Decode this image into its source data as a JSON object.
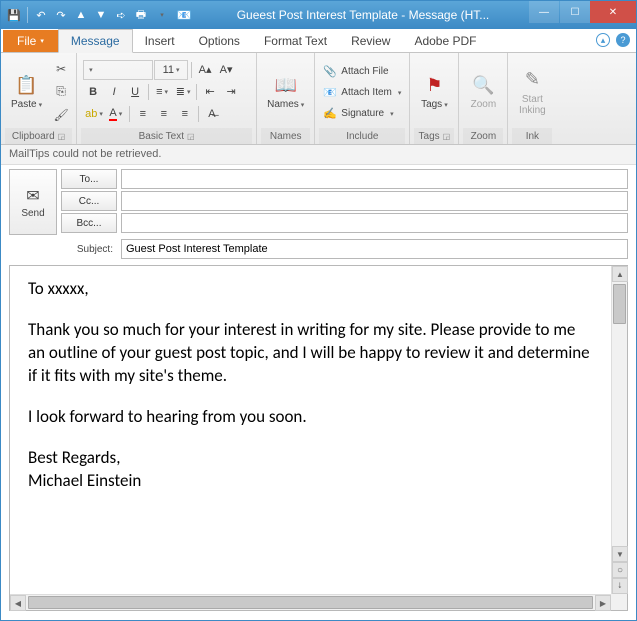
{
  "window": {
    "title": "Gueest Post Interest Template - Message (HT..."
  },
  "tabs": {
    "file": "File",
    "message": "Message",
    "insert": "Insert",
    "options": "Options",
    "format_text": "Format Text",
    "review": "Review",
    "adobe_pdf": "Adobe PDF"
  },
  "ribbon": {
    "clipboard": {
      "label": "Clipboard",
      "paste": "Paste"
    },
    "basic_text": {
      "label": "Basic Text",
      "font_size": "11"
    },
    "names": {
      "label": "Names",
      "names_btn": "Names"
    },
    "include": {
      "label": "Include",
      "attach_file": "Attach File",
      "attach_item": "Attach Item",
      "signature": "Signature"
    },
    "tags": {
      "label": "Tags",
      "tags_btn": "Tags"
    },
    "zoom": {
      "label": "Zoom",
      "zoom_btn": "Zoom"
    },
    "ink": {
      "label": "Ink",
      "start_inking": "Start\nInking"
    }
  },
  "mailtips": "MailTips could not be retrieved.",
  "compose": {
    "send": "Send",
    "to": "To...",
    "cc": "Cc...",
    "bcc": "Bcc...",
    "subject_label": "Subject:",
    "subject_value": "Guest Post Interest Template",
    "to_value": "",
    "cc_value": "",
    "bcc_value": ""
  },
  "body": {
    "greeting": "To xxxxx,",
    "p1": "Thank you so much for your interest in writing for my site. Please provide to me an outline of your guest post topic, and I will be happy to review it and determine if it fits with my site's theme.",
    "p2": "I look forward to hearing from you soon.",
    "closing": "Best Regards,",
    "signature": "Michael Einstein"
  }
}
